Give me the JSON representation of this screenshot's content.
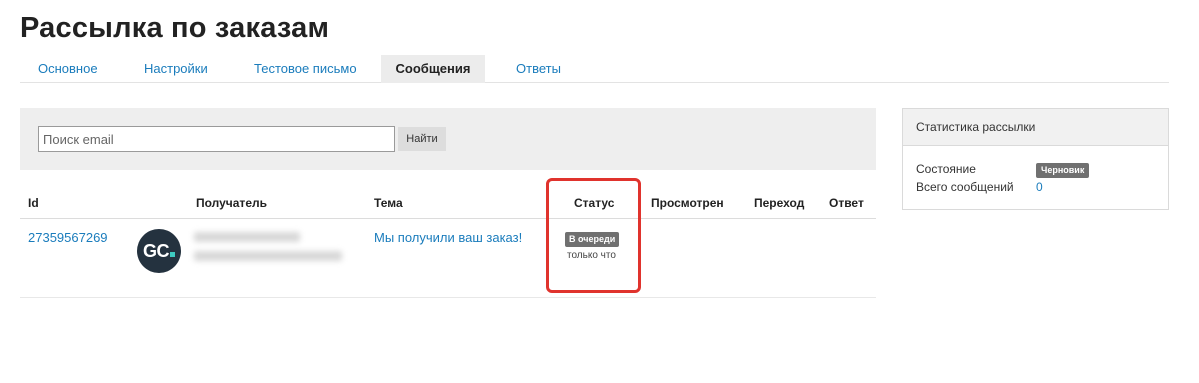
{
  "page": {
    "title": "Рассылка по заказам"
  },
  "tabs": [
    {
      "label": "Основное"
    },
    {
      "label": "Настройки"
    },
    {
      "label": "Тестовое письмо"
    },
    {
      "label": "Сообщения",
      "active": true
    },
    {
      "label": "Ответы"
    }
  ],
  "search": {
    "placeholder": "Поиск email",
    "value": "",
    "button_label": "Найти"
  },
  "table": {
    "columns": [
      "Id",
      "Получатель",
      "Тема",
      "Статус",
      "Просмотрен",
      "Переход",
      "Ответ"
    ],
    "rows": [
      {
        "id": "27359567269",
        "avatar_text": "GC",
        "subject": "Мы получили ваш заказ!",
        "status": "В очереди",
        "status_time": "только что",
        "viewed": "",
        "click": "",
        "reply": ""
      }
    ]
  },
  "stats": {
    "title": "Статистика рассылки",
    "state_label": "Состояние",
    "state_value": "Черновик",
    "total_label": "Всего сообщений",
    "total_value": "0"
  },
  "colors": {
    "link": "#1a7cbc",
    "badge": "#707070",
    "highlight": "#e0332d",
    "avatar_bg": "#24323f",
    "avatar_accent": "#3ecbc1"
  }
}
